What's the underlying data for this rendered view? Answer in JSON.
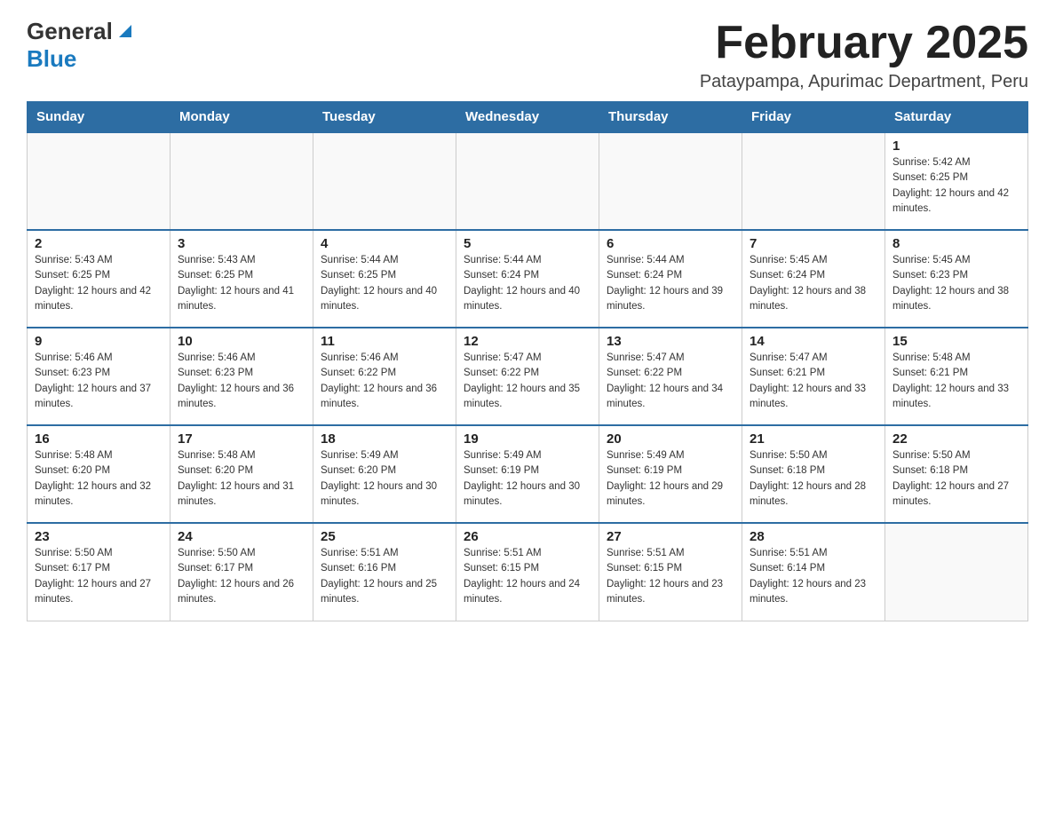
{
  "header": {
    "logo_general": "General",
    "logo_blue": "Blue",
    "month_title": "February 2025",
    "location": "Pataypampa, Apurimac Department, Peru"
  },
  "days_of_week": [
    "Sunday",
    "Monday",
    "Tuesday",
    "Wednesday",
    "Thursday",
    "Friday",
    "Saturday"
  ],
  "weeks": [
    [
      {
        "day": "",
        "info": ""
      },
      {
        "day": "",
        "info": ""
      },
      {
        "day": "",
        "info": ""
      },
      {
        "day": "",
        "info": ""
      },
      {
        "day": "",
        "info": ""
      },
      {
        "day": "",
        "info": ""
      },
      {
        "day": "1",
        "info": "Sunrise: 5:42 AM\nSunset: 6:25 PM\nDaylight: 12 hours and 42 minutes."
      }
    ],
    [
      {
        "day": "2",
        "info": "Sunrise: 5:43 AM\nSunset: 6:25 PM\nDaylight: 12 hours and 42 minutes."
      },
      {
        "day": "3",
        "info": "Sunrise: 5:43 AM\nSunset: 6:25 PM\nDaylight: 12 hours and 41 minutes."
      },
      {
        "day": "4",
        "info": "Sunrise: 5:44 AM\nSunset: 6:25 PM\nDaylight: 12 hours and 40 minutes."
      },
      {
        "day": "5",
        "info": "Sunrise: 5:44 AM\nSunset: 6:24 PM\nDaylight: 12 hours and 40 minutes."
      },
      {
        "day": "6",
        "info": "Sunrise: 5:44 AM\nSunset: 6:24 PM\nDaylight: 12 hours and 39 minutes."
      },
      {
        "day": "7",
        "info": "Sunrise: 5:45 AM\nSunset: 6:24 PM\nDaylight: 12 hours and 38 minutes."
      },
      {
        "day": "8",
        "info": "Sunrise: 5:45 AM\nSunset: 6:23 PM\nDaylight: 12 hours and 38 minutes."
      }
    ],
    [
      {
        "day": "9",
        "info": "Sunrise: 5:46 AM\nSunset: 6:23 PM\nDaylight: 12 hours and 37 minutes."
      },
      {
        "day": "10",
        "info": "Sunrise: 5:46 AM\nSunset: 6:23 PM\nDaylight: 12 hours and 36 minutes."
      },
      {
        "day": "11",
        "info": "Sunrise: 5:46 AM\nSunset: 6:22 PM\nDaylight: 12 hours and 36 minutes."
      },
      {
        "day": "12",
        "info": "Sunrise: 5:47 AM\nSunset: 6:22 PM\nDaylight: 12 hours and 35 minutes."
      },
      {
        "day": "13",
        "info": "Sunrise: 5:47 AM\nSunset: 6:22 PM\nDaylight: 12 hours and 34 minutes."
      },
      {
        "day": "14",
        "info": "Sunrise: 5:47 AM\nSunset: 6:21 PM\nDaylight: 12 hours and 33 minutes."
      },
      {
        "day": "15",
        "info": "Sunrise: 5:48 AM\nSunset: 6:21 PM\nDaylight: 12 hours and 33 minutes."
      }
    ],
    [
      {
        "day": "16",
        "info": "Sunrise: 5:48 AM\nSunset: 6:20 PM\nDaylight: 12 hours and 32 minutes."
      },
      {
        "day": "17",
        "info": "Sunrise: 5:48 AM\nSunset: 6:20 PM\nDaylight: 12 hours and 31 minutes."
      },
      {
        "day": "18",
        "info": "Sunrise: 5:49 AM\nSunset: 6:20 PM\nDaylight: 12 hours and 30 minutes."
      },
      {
        "day": "19",
        "info": "Sunrise: 5:49 AM\nSunset: 6:19 PM\nDaylight: 12 hours and 30 minutes."
      },
      {
        "day": "20",
        "info": "Sunrise: 5:49 AM\nSunset: 6:19 PM\nDaylight: 12 hours and 29 minutes."
      },
      {
        "day": "21",
        "info": "Sunrise: 5:50 AM\nSunset: 6:18 PM\nDaylight: 12 hours and 28 minutes."
      },
      {
        "day": "22",
        "info": "Sunrise: 5:50 AM\nSunset: 6:18 PM\nDaylight: 12 hours and 27 minutes."
      }
    ],
    [
      {
        "day": "23",
        "info": "Sunrise: 5:50 AM\nSunset: 6:17 PM\nDaylight: 12 hours and 27 minutes."
      },
      {
        "day": "24",
        "info": "Sunrise: 5:50 AM\nSunset: 6:17 PM\nDaylight: 12 hours and 26 minutes."
      },
      {
        "day": "25",
        "info": "Sunrise: 5:51 AM\nSunset: 6:16 PM\nDaylight: 12 hours and 25 minutes."
      },
      {
        "day": "26",
        "info": "Sunrise: 5:51 AM\nSunset: 6:15 PM\nDaylight: 12 hours and 24 minutes."
      },
      {
        "day": "27",
        "info": "Sunrise: 5:51 AM\nSunset: 6:15 PM\nDaylight: 12 hours and 23 minutes."
      },
      {
        "day": "28",
        "info": "Sunrise: 5:51 AM\nSunset: 6:14 PM\nDaylight: 12 hours and 23 minutes."
      },
      {
        "day": "",
        "info": ""
      }
    ]
  ]
}
